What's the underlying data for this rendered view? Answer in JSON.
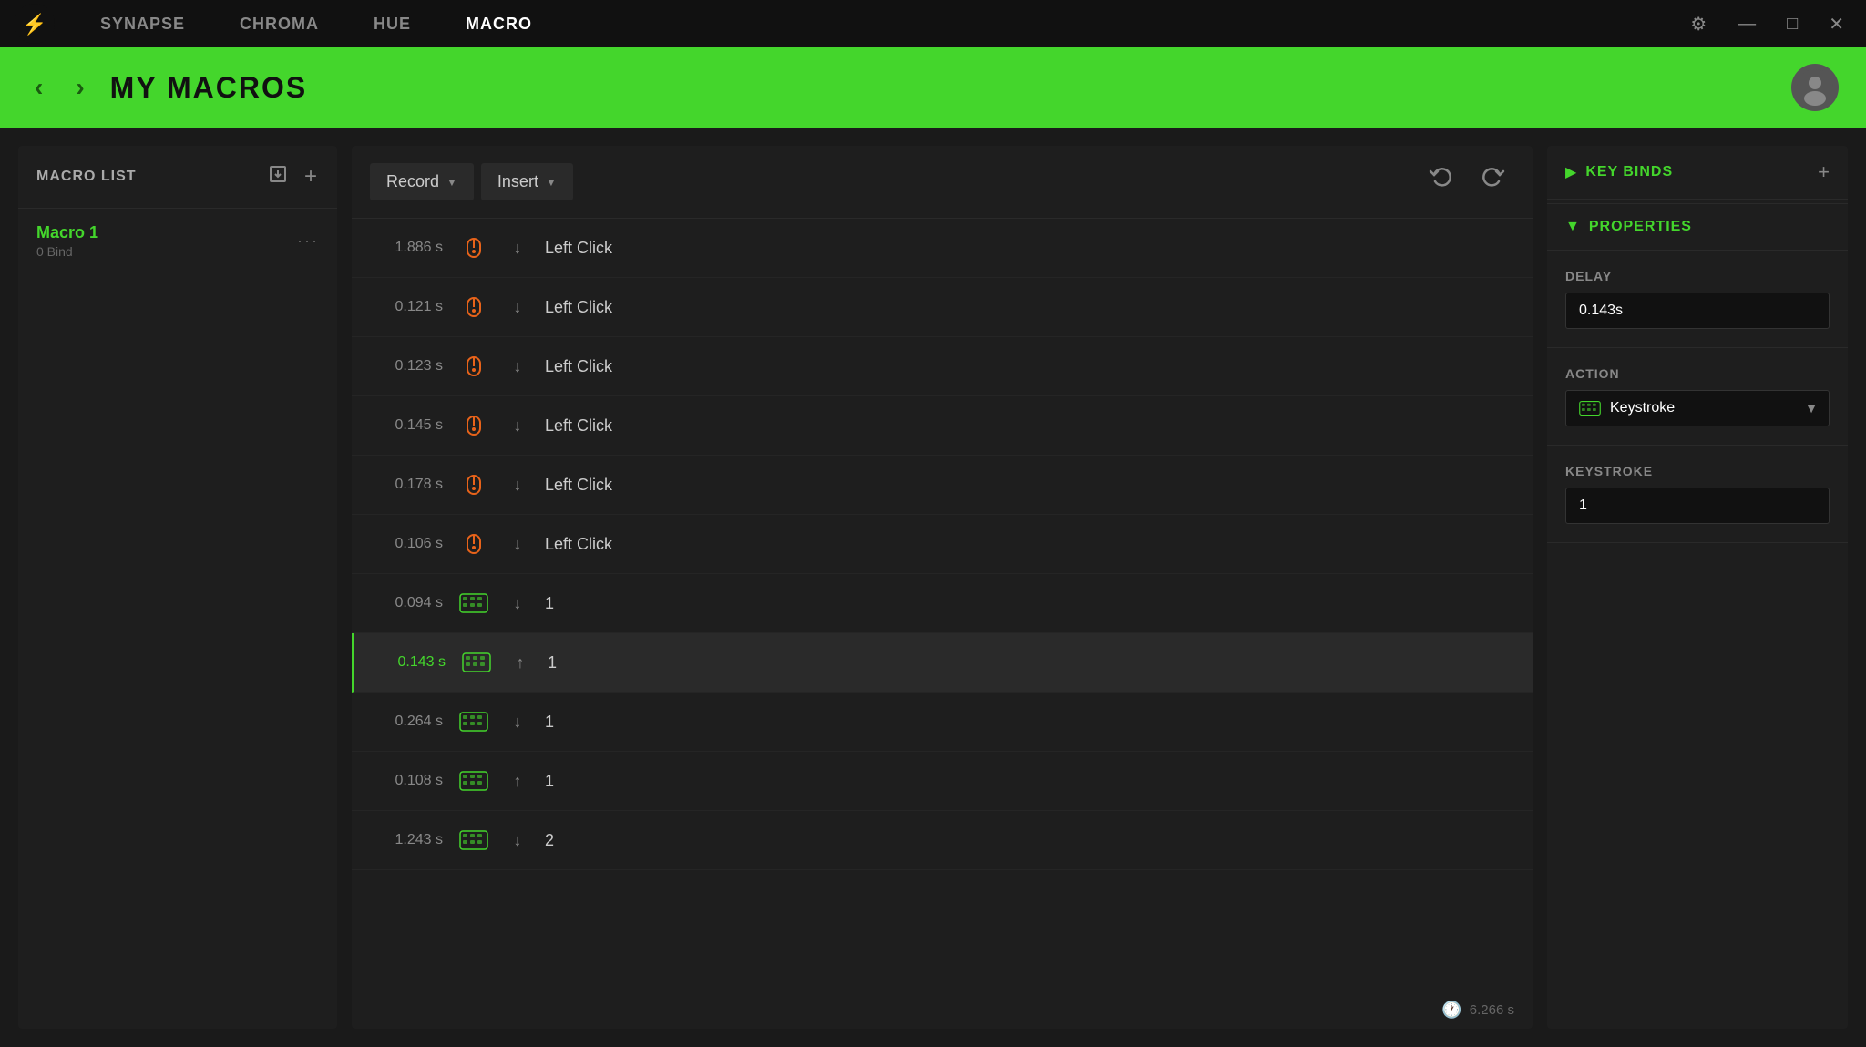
{
  "titlebar": {
    "tabs": [
      {
        "id": "synapse",
        "label": "SYNAPSE",
        "active": false
      },
      {
        "id": "chroma",
        "label": "CHROMA",
        "active": false
      },
      {
        "id": "hue",
        "label": "HUE",
        "active": false
      },
      {
        "id": "macro",
        "label": "MACRO",
        "active": true
      }
    ],
    "settings_icon": "⚙",
    "minimize_icon": "—",
    "maximize_icon": "□",
    "close_icon": "✕"
  },
  "header": {
    "title": "MY MACROS",
    "back_label": "‹",
    "forward_label": "›"
  },
  "macro_list": {
    "panel_title": "MACRO LIST",
    "macros": [
      {
        "name": "Macro 1",
        "bind": "0 Bind"
      }
    ]
  },
  "toolbar": {
    "record_label": "Record",
    "insert_label": "Insert",
    "undo_label": "↺",
    "redo_label": "↻"
  },
  "macro_rows": [
    {
      "time": "1.886 s",
      "type": "mouse",
      "direction": "down",
      "label": "Left Click",
      "highlight": false
    },
    {
      "time": "0.121 s",
      "type": "mouse",
      "direction": "down",
      "label": "Left Click",
      "highlight": false
    },
    {
      "time": "0.123 s",
      "type": "mouse",
      "direction": "down",
      "label": "Left Click",
      "highlight": false
    },
    {
      "time": "0.145 s",
      "type": "mouse",
      "direction": "down",
      "label": "Left Click",
      "highlight": false
    },
    {
      "time": "0.178 s",
      "type": "mouse",
      "direction": "down",
      "label": "Left Click",
      "highlight": false
    },
    {
      "time": "0.106 s",
      "type": "mouse",
      "direction": "down",
      "label": "Left Click",
      "highlight": false
    },
    {
      "time": "0.094 s",
      "type": "keyboard",
      "direction": "down",
      "label": "1",
      "highlight": false
    },
    {
      "time": "0.143 s",
      "type": "keyboard",
      "direction": "up",
      "label": "1",
      "highlight": true
    },
    {
      "time": "0.264 s",
      "type": "keyboard",
      "direction": "down",
      "label": "1",
      "highlight": false
    },
    {
      "time": "0.108 s",
      "type": "keyboard",
      "direction": "up",
      "label": "1",
      "highlight": false
    },
    {
      "time": "1.243 s",
      "type": "keyboard",
      "direction": "down",
      "label": "2",
      "highlight": false
    }
  ],
  "footer": {
    "clock_icon": "🕐",
    "total_time": "6.266 s"
  },
  "key_binds": {
    "title": "KEY BINDS"
  },
  "properties": {
    "title": "PROPERTIES",
    "delay_label": "DELAY",
    "delay_value": "0.143s",
    "action_label": "ACTION",
    "action_value": "Keystroke",
    "keystroke_label": "KEYSTROKE",
    "keystroke_value": "1"
  },
  "colors": {
    "green": "#44d62c",
    "orange": "#e8631a",
    "dark_bg": "#1a1a1a",
    "panel_bg": "#1e1e1e",
    "header_bg": "#44d62c"
  }
}
